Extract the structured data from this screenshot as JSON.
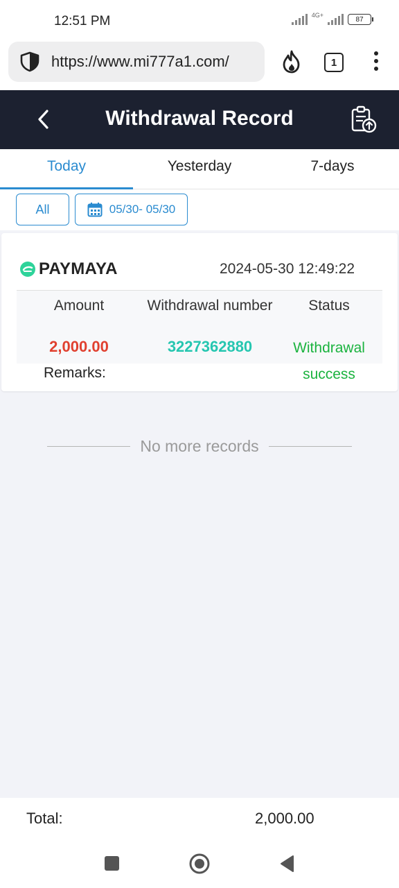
{
  "status_bar": {
    "time": "12:51 PM",
    "network": "4G+",
    "battery": "87"
  },
  "browser": {
    "url": "https://www.mi777a1.com/",
    "tab_count": "1"
  },
  "header": {
    "title": "Withdrawal Record"
  },
  "tabs": [
    {
      "label": "Today",
      "active": true
    },
    {
      "label": "Yesterday",
      "active": false
    },
    {
      "label": "7-days",
      "active": false
    }
  ],
  "filters": {
    "all_label": "All",
    "date_range": "05/30- 05/30"
  },
  "record": {
    "provider": "PAYMAYA",
    "datetime": "2024-05-30 12:49:22",
    "columns": {
      "amount": "Amount",
      "number": "Withdrawal number",
      "status": "Status"
    },
    "amount": "2,000.00",
    "withdrawal_number": "3227362880",
    "status_line1": "Withdrawal",
    "status_line2": "success",
    "remarks_label": "Remarks:"
  },
  "list_end": {
    "text": "No more records"
  },
  "total": {
    "label": "Total:",
    "value": "2,000.00"
  },
  "colors": {
    "header_bg": "#1c2130",
    "accent": "#2a8bd0",
    "amount": "#e0402f",
    "number": "#25c6b0",
    "status": "#1bb33f"
  }
}
